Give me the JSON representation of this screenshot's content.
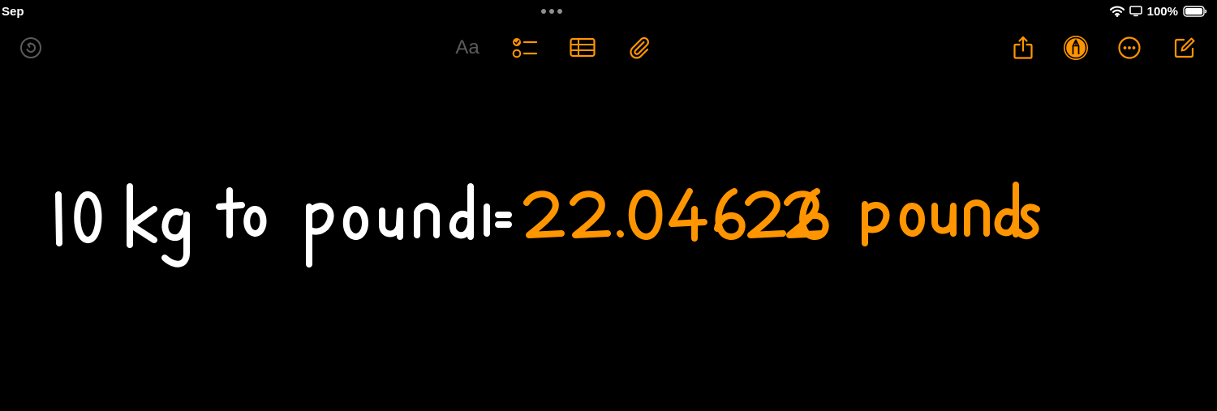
{
  "status_bar": {
    "time": "Sep",
    "battery_percent": "100%",
    "icons": [
      "wifi-icon",
      "screen-mirroring-icon",
      "battery-icon"
    ]
  },
  "toolbar": {
    "format_label": "Aa",
    "left_icons": [
      "undo-redo-circle-icon"
    ],
    "center_icons": [
      "format-text-icon",
      "checklist-icon",
      "table-icon",
      "paperclip-icon"
    ],
    "right_icons": [
      "share-icon",
      "markup-pen-icon",
      "more-icon",
      "compose-icon"
    ]
  },
  "note": {
    "expression_text": "10 kg to pounds =",
    "result_text": "22.046226 pounds"
  },
  "colors": {
    "accent": "#ff9500",
    "background": "#000000",
    "ink": "#ffffff",
    "disabled": "#5b5b5f"
  }
}
